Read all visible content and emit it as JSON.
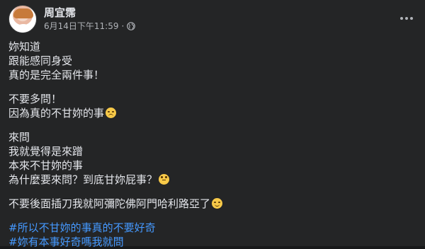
{
  "post": {
    "author": "周宜霈",
    "timestamp": "6月14日下午11:59",
    "separator": "·",
    "privacy_icon": "globe-icon",
    "more_icon": "more-options-icon"
  },
  "content": {
    "para1": [
      "妳知道",
      "跟能感同身受",
      "真的是完全兩件事！"
    ],
    "para2_line1": "不要多問！",
    "para2_line2": "因為真的不甘妳的事",
    "para3_line1": "來問",
    "para3_line2": "我就覺得是來蹭",
    "para3_line3": "本來不甘妳的事",
    "para3_line4": "為什麼要來問？到底甘妳屁事？",
    "para4": "不要後面插刀我就阿彌陀佛阿門哈利路亞了",
    "hashtags": [
      "#所以不甘妳的事真的不要好奇",
      "#妳有本事好奇嗎我就問"
    ]
  },
  "colors": {
    "background": "#242526",
    "text": "#e4e6eb",
    "secondary_text": "#b0b3b8",
    "hashtag": "#4599ff"
  }
}
